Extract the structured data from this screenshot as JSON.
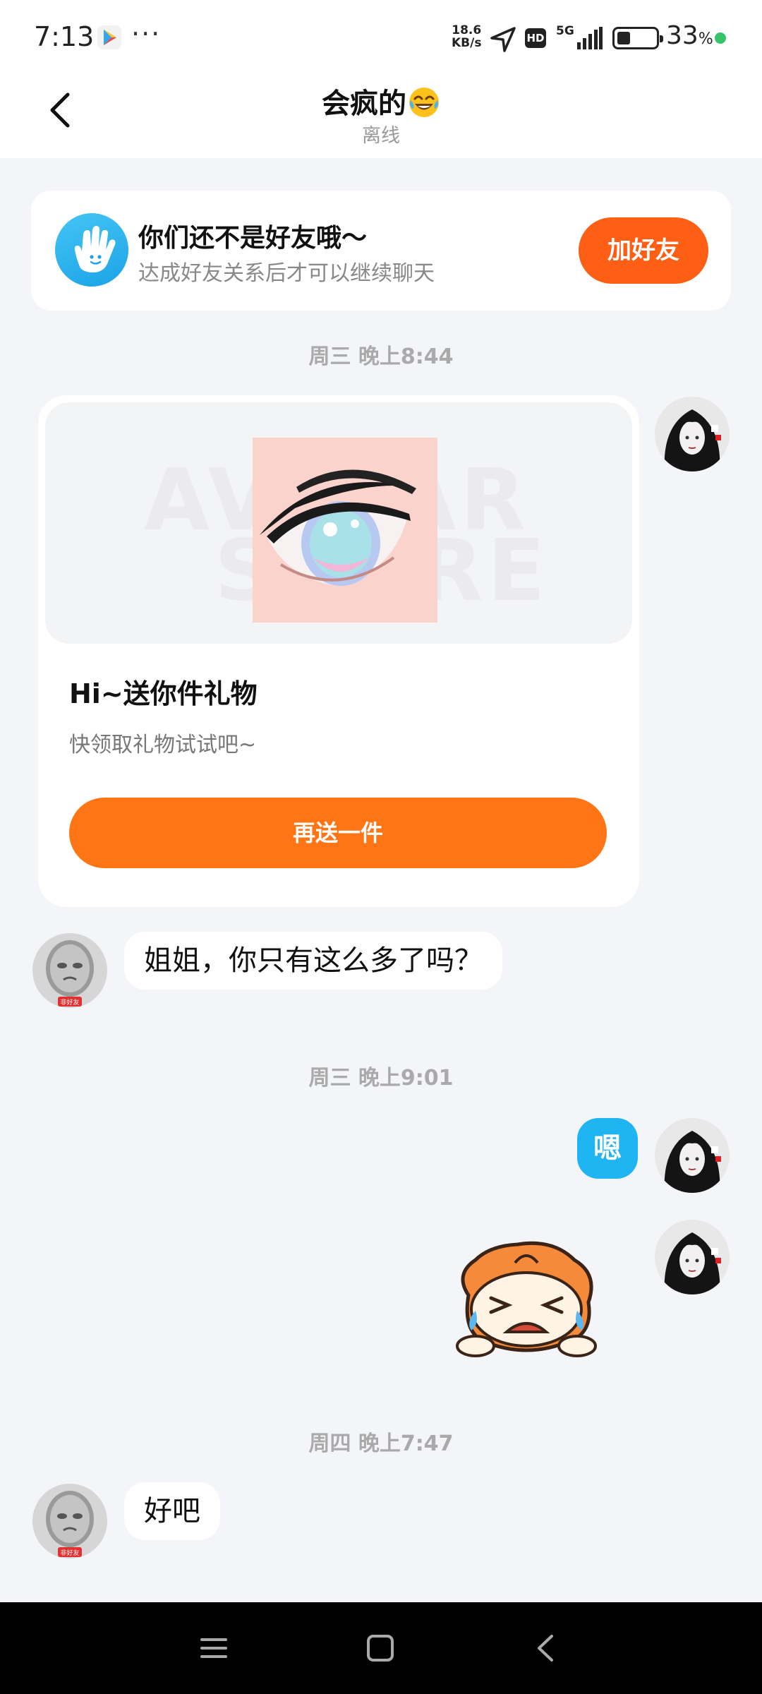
{
  "status_bar": {
    "time": "7:13",
    "dots": "···",
    "speed_value": "18.6",
    "speed_unit": "KB/s",
    "hd": "HD",
    "network": "5G",
    "battery_percent": "33",
    "battery_unit": "%",
    "battery_level": 0.33,
    "dot_color": "#35c46a"
  },
  "header": {
    "title": "会疯的",
    "title_emoji": "face-with-tears-of-joy",
    "subtitle": "离线"
  },
  "friend_banner": {
    "title": "你们还不是好友哦～",
    "subtitle": "达成好友关系后才可以继续聊天",
    "button_label": "加好友",
    "icon": "hand-wave-icon"
  },
  "messages": {
    "timestamp_1": "周三 晚上8:44",
    "gift_card": {
      "watermark_line1": "AVATAR",
      "watermark_line2": "STORE",
      "title": "Hi~送你件礼物",
      "subtitle": "快领取礼物试试吧~",
      "button_label": "再送一件"
    },
    "incoming_1": "姐姐，你只有这么多了吗？",
    "timestamp_2": "周三 晚上9:01",
    "outgoing_1": "嗯",
    "sticker": "crying-cartoon-sticker",
    "timestamp_3": "周四 晚上7:47",
    "incoming_2": "好吧",
    "avatar_badge": "非好友"
  },
  "colors": {
    "accent_orange": "#ff5f14",
    "button_orange": "#ff7414",
    "my_bubble_blue": "#1fb5f3",
    "background": "#f3f5f8"
  }
}
